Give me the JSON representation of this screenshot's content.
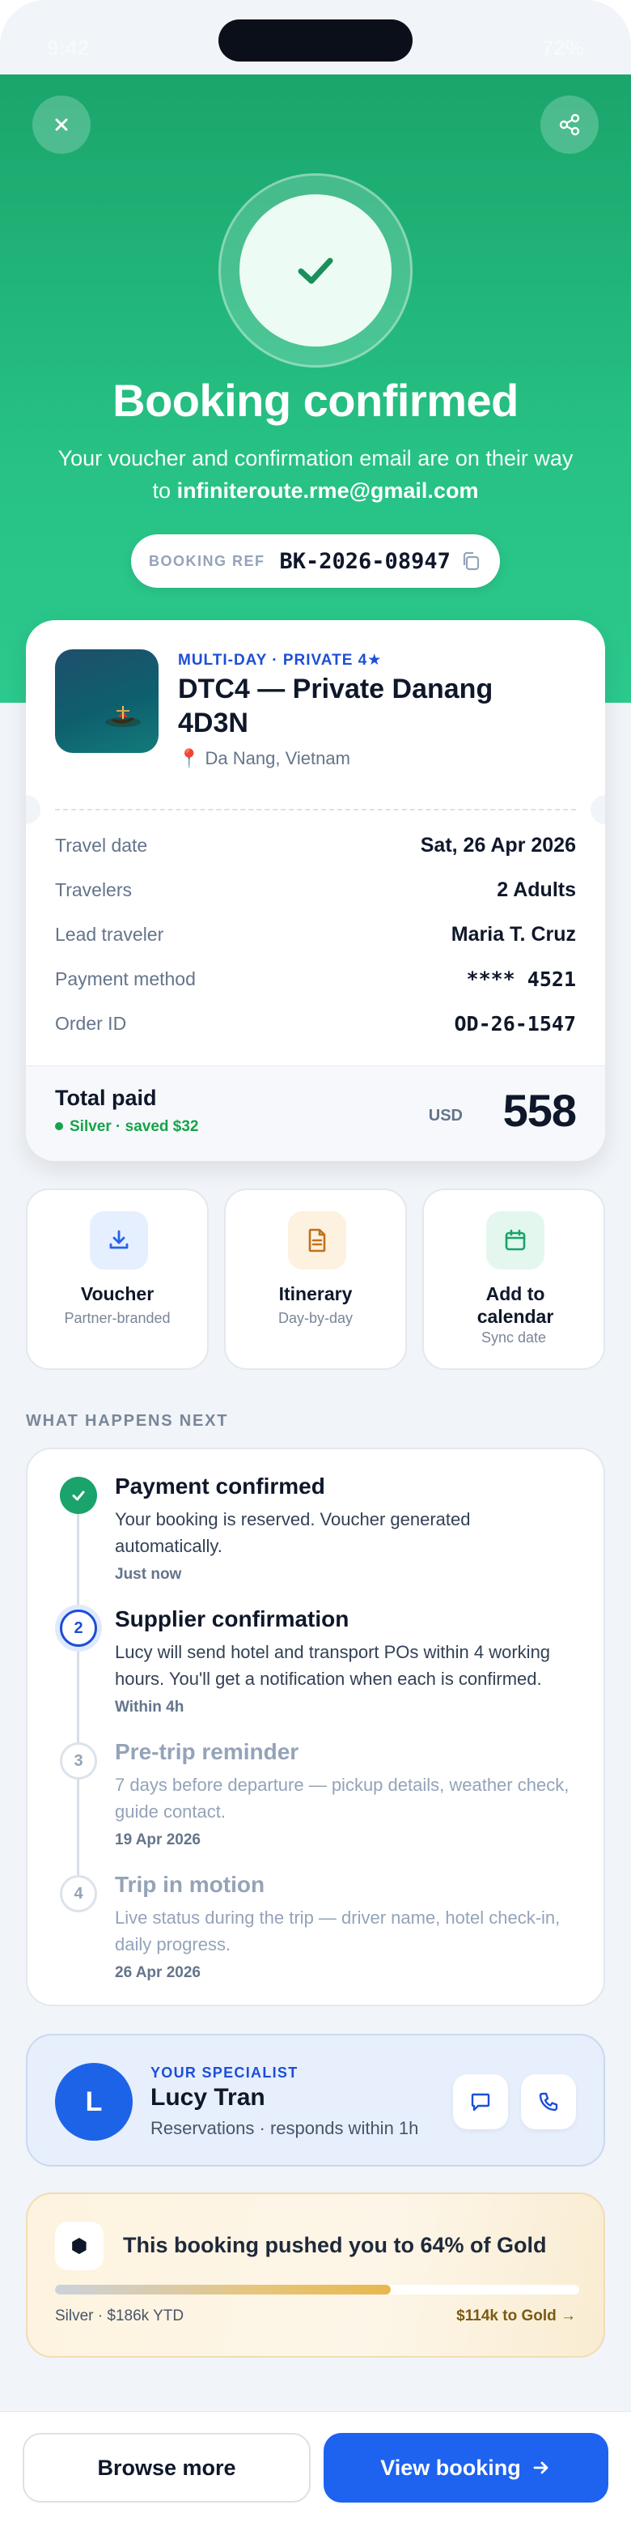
{
  "status_bar": {
    "time": "9:42",
    "battery": "72%"
  },
  "header": {
    "title": "Booking confirmed",
    "subtitle_prefix": "Your voucher and confirmation email are on their way to ",
    "email": "infiniteroute.rme@gmail.com",
    "booking_ref_label": "BOOKING REF",
    "booking_ref": "BK-2026-08947",
    "icons": {
      "close": "close-icon",
      "share": "share-icon",
      "copy": "copy-icon",
      "success": "check-icon"
    }
  },
  "booking": {
    "tag": "MULTI-DAY · PRIVATE 4★",
    "title": "DTC4 — Private Danang 4D3N",
    "location": "Da Nang, Vietnam",
    "details": [
      {
        "label": "Travel date",
        "value": "Sat, 26 Apr 2026"
      },
      {
        "label": "Travelers",
        "value": "2 Adults"
      },
      {
        "label": "Lead traveler",
        "value": "Maria T. Cruz"
      },
      {
        "label": "Payment method",
        "value": "**** 4521"
      },
      {
        "label": "Order ID",
        "value": "OD-26-1547"
      }
    ],
    "total_label": "Total paid",
    "tier_saved": "Silver · saved $32",
    "currency": "USD",
    "total_amount": "558"
  },
  "actions": [
    {
      "title": "Voucher",
      "subtitle": "Partner-branded",
      "icon": "download-icon",
      "color": "#2563eb",
      "bg": "#e5efff"
    },
    {
      "title": "Itinerary",
      "subtitle": "Day-by-day",
      "icon": "document-icon",
      "color": "#c2701b",
      "bg": "#fdf1df"
    },
    {
      "title": "Add to calendar",
      "subtitle": "Sync date",
      "icon": "calendar-icon",
      "color": "#15a36a",
      "bg": "#e3f7ee"
    }
  ],
  "next_steps": {
    "section_label": "WHAT HAPPENS NEXT",
    "steps": [
      {
        "number": "",
        "title": "Payment confirmed",
        "description": "Your booking is reserved. Voucher generated automatically.",
        "when": "Just now",
        "state": "done"
      },
      {
        "number": "2",
        "title": "Supplier confirmation",
        "description": "Lucy will send hotel and transport POs within 4 working hours. You'll get a notification when each is confirmed.",
        "when": "Within 4h",
        "state": "active"
      },
      {
        "number": "3",
        "title": "Pre-trip reminder",
        "description": "7 days before departure — pickup details, weather check, guide contact.",
        "when": "19 Apr 2026",
        "state": "pending"
      },
      {
        "number": "4",
        "title": "Trip in motion",
        "description": "Live status during the trip — driver name, hotel check-in, daily progress.",
        "when": "26 Apr 2026",
        "state": "pending"
      }
    ]
  },
  "specialist": {
    "tag": "YOUR SPECIALIST",
    "initial": "L",
    "name": "Lucy Tran",
    "meta": "Reservations · responds within 1h"
  },
  "loyalty": {
    "message": "This booking pushed you to 64% of Gold",
    "progress": 0.64,
    "left_label": "Silver · $186k YTD",
    "right_label": "$114k to Gold →"
  },
  "footer": {
    "secondary_label": "Browse more",
    "primary_label": "View booking"
  }
}
